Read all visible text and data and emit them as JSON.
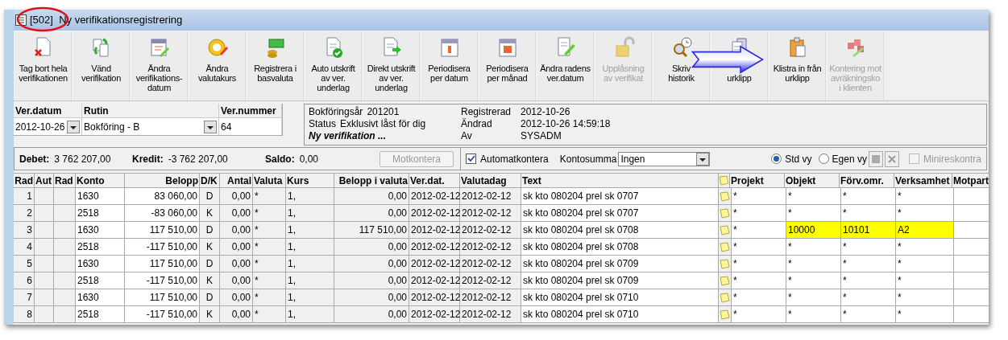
{
  "window": {
    "title": "[502]  Ny verifikationsregistrering"
  },
  "toolbar": [
    {
      "lines": [
        "Tag bort hela",
        "verifikationen"
      ],
      "disabled": false
    },
    {
      "lines": [
        "Vänd",
        "verifikation"
      ],
      "disabled": false
    },
    {
      "lines": [
        "Ändra",
        "verifikations-",
        "datum"
      ],
      "disabled": false
    },
    {
      "lines": [
        "Ändra",
        "valutakurs"
      ],
      "disabled": false
    },
    {
      "lines": [
        "Registrera i",
        "basvaluta"
      ],
      "disabled": false
    },
    {
      "lines": [
        "Auto utskrift",
        "av ver.",
        "underlag"
      ],
      "disabled": false
    },
    {
      "lines": [
        "Direkt utskrift",
        "av ver.",
        "underlag"
      ],
      "disabled": false
    },
    {
      "lines": [
        "Periodisera",
        "per datum"
      ],
      "disabled": false
    },
    {
      "lines": [
        "Periodisera",
        "per månad"
      ],
      "disabled": false
    },
    {
      "lines": [
        "Ändra radens",
        "ver.datum"
      ],
      "disabled": false
    },
    {
      "lines": [
        "Upplåsning",
        "av verifikat"
      ],
      "disabled": true
    },
    {
      "lines": [
        "Skriv",
        "historik"
      ],
      "disabled": false
    },
    {
      "lines": [
        "urklipp"
      ],
      "disabled": false
    },
    {
      "lines": [
        "Klistra in från",
        "urklipp"
      ],
      "disabled": false
    },
    {
      "lines": [
        "Kontering mot",
        "avräkningsko",
        "i klienten"
      ],
      "disabled": true
    }
  ],
  "header_fields": [
    {
      "label": "Ver.datum",
      "value": "2012-10-26",
      "kind": "dropdown"
    },
    {
      "label": "Rutin",
      "value": "Bokföring - B",
      "kind": "dropdown"
    },
    {
      "label": "Ver.nummer",
      "value": "64",
      "kind": "text"
    }
  ],
  "info": {
    "left": [
      {
        "label": "Bokföringsår",
        "value": "201201"
      },
      {
        "label": "Status",
        "value": "Exklusivt låst för dig"
      }
    ],
    "note": "Ny verifikation ...",
    "right": [
      {
        "label": "Registrerad",
        "value": "2012-10-26"
      },
      {
        "label": "Ändrad",
        "value": "2012-10-26 14:59:18"
      },
      {
        "label": "Av",
        "value": "SYSADM"
      }
    ]
  },
  "totals": [
    {
      "label": "Debet:",
      "value": "3 762 207,00"
    },
    {
      "label": "Kredit:",
      "value": "-3 762 207,00"
    },
    {
      "label": "Saldo:",
      "value": "0,00"
    }
  ],
  "motkontera": {
    "label": "Motkontera",
    "disabled": true
  },
  "automatkontera": {
    "label": "Automatkontera",
    "checked": true
  },
  "kontosumma": {
    "label": "Kontosumma",
    "value": "Ingen"
  },
  "views": [
    {
      "label": "Std vy",
      "selected": true
    },
    {
      "label": "Egen vy",
      "selected": false
    }
  ],
  "minireskontra": {
    "label": "Minireskontra",
    "checked": false,
    "disabled": true
  },
  "table": {
    "columns": [
      "Rad",
      "Aut",
      "Rad",
      "Konto",
      "Belopp",
      "D/K",
      "Antal",
      "Valuta",
      "Kurs",
      "Belopp i valuta",
      "Ver.dat.",
      "Valutadag",
      "Text",
      "Projekt",
      "Objekt",
      "Förv.omr.",
      "Verksamhet",
      "Motpart"
    ],
    "rows": [
      {
        "rad": "1",
        "konto": "1630",
        "belopp": "83 060,00",
        "dk": "D",
        "antal": "0,00",
        "valuta": "*",
        "kurs": "1,",
        "belopp_valuta": "0,00",
        "verdat": "2012-02-12",
        "valutadag": "2012-02-12",
        "text": "sk kto 080204 prel sk 0707",
        "projekt": "*",
        "objekt": "*",
        "forv": "*",
        "verksamhet": "*",
        "highlighted": false
      },
      {
        "rad": "2",
        "konto": "2518",
        "belopp": "-83 060,00",
        "dk": "K",
        "antal": "0,00",
        "valuta": "*",
        "kurs": "1,",
        "belopp_valuta": "0,00",
        "verdat": "2012-02-12",
        "valutadag": "2012-02-12",
        "text": "sk kto 080204 prel sk 0707",
        "projekt": "*",
        "objekt": "*",
        "forv": "*",
        "verksamhet": "*",
        "highlighted": false
      },
      {
        "rad": "3",
        "konto": "1630",
        "belopp": "117 510,00",
        "dk": "D",
        "antal": "0,00",
        "valuta": "*",
        "kurs": "1,",
        "belopp_valuta": "117 510,00",
        "verdat": "2012-02-12",
        "valutadag": "2012-02-12",
        "text": "sk kto 080204 prel sk 0708",
        "projekt": "*",
        "objekt": "10000",
        "forv": "10101",
        "verksamhet": "A2",
        "highlighted": true
      },
      {
        "rad": "4",
        "konto": "2518",
        "belopp": "-117 510,00",
        "dk": "K",
        "antal": "0,00",
        "valuta": "*",
        "kurs": "1,",
        "belopp_valuta": "0,00",
        "verdat": "2012-02-12",
        "valutadag": "2012-02-12",
        "text": "sk kto 080204 prel sk 0708",
        "projekt": "*",
        "objekt": "*",
        "forv": "*",
        "verksamhet": "*",
        "highlighted": false
      },
      {
        "rad": "5",
        "konto": "1630",
        "belopp": "117 510,00",
        "dk": "D",
        "antal": "0,00",
        "valuta": "*",
        "kurs": "1,",
        "belopp_valuta": "0,00",
        "verdat": "2012-02-12",
        "valutadag": "2012-02-12",
        "text": "sk kto 080204 prel sk 0709",
        "projekt": "*",
        "objekt": "*",
        "forv": "*",
        "verksamhet": "*",
        "highlighted": false
      },
      {
        "rad": "6",
        "konto": "2518",
        "belopp": "-117 510,00",
        "dk": "K",
        "antal": "0,00",
        "valuta": "*",
        "kurs": "1,",
        "belopp_valuta": "0,00",
        "verdat": "2012-02-12",
        "valutadag": "2012-02-12",
        "text": "sk kto 080204 prel sk 0709",
        "projekt": "*",
        "objekt": "*",
        "forv": "*",
        "verksamhet": "*",
        "highlighted": false
      },
      {
        "rad": "7",
        "konto": "1630",
        "belopp": "117 510,00",
        "dk": "D",
        "antal": "0,00",
        "valuta": "*",
        "kurs": "1,",
        "belopp_valuta": "0,00",
        "verdat": "2012-02-12",
        "valutadag": "2012-02-12",
        "text": "sk kto 080204 prel sk 0710",
        "projekt": "*",
        "objekt": "*",
        "forv": "*",
        "verksamhet": "*",
        "highlighted": false
      },
      {
        "rad": "8",
        "konto": "2518",
        "belopp": "-117 510,00",
        "dk": "K",
        "antal": "0,00",
        "valuta": "*",
        "kurs": "1,",
        "belopp_valuta": "0,00",
        "verdat": "2012-02-12",
        "valutadag": "2012-02-12",
        "text": "sk kto 080204 prel sk 0710",
        "projekt": "*",
        "objekt": "*",
        "forv": "*",
        "verksamhet": "*",
        "highlighted": false
      }
    ]
  }
}
